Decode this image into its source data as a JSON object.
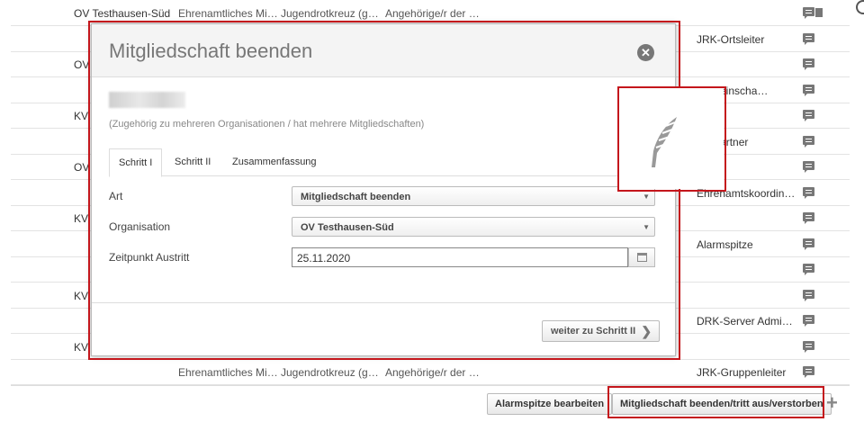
{
  "rows": [
    {
      "org": "OV Testhausen-Süd",
      "func": "Ehrenamtliches Mi…",
      "group": "Jugendrotkreuz (g…",
      "member": "Angehörige/r der …",
      "role": "",
      "icons": "comment-trash"
    },
    {
      "org": "",
      "func": "",
      "group": "",
      "member": "",
      "role": "JRK-Ortsleiter",
      "icons": "comment"
    },
    {
      "org": "OV",
      "func": "",
      "group": "",
      "member": "",
      "role": "",
      "icons": "comment"
    },
    {
      "org": "",
      "func": "",
      "group": "",
      "member": "",
      "role": "Gemeinscha…",
      "icons": "comment"
    },
    {
      "org": "KV",
      "func": "",
      "group": "",
      "member": "",
      "role": "",
      "icons": "comment"
    },
    {
      "org": "",
      "func": "",
      "group": "",
      "member": "",
      "role": "echpartner",
      "icons": "comment"
    },
    {
      "org": "OV",
      "func": "",
      "group": "",
      "member": "",
      "role": "",
      "icons": "comment"
    },
    {
      "org": "",
      "func": "",
      "group": "",
      "member": "",
      "role": "Ehrenamtskoordin…",
      "icons": "comment"
    },
    {
      "org": "KV",
      "func": "",
      "group": "",
      "member": "",
      "role": "",
      "icons": "comment"
    },
    {
      "org": "",
      "func": "",
      "group": "",
      "member": "",
      "role": "Alarmspitze",
      "icons": "comment"
    },
    {
      "org": "",
      "func": "",
      "group": "",
      "member": "",
      "role": "",
      "icons": "comment"
    },
    {
      "org": "KV",
      "func": "",
      "group": "",
      "member": "",
      "role": "",
      "icons": "comment"
    },
    {
      "org": "",
      "func": "",
      "group": "",
      "member": "",
      "role": "DRK-Server Admi…",
      "icons": "comment"
    },
    {
      "org": "KV",
      "func": "",
      "group": "",
      "member": "",
      "role": "",
      "icons": "comment"
    },
    {
      "org": "",
      "func": "Ehrenamtliches Mi…",
      "group": "Jugendrotkreuz (g…",
      "member": "Angehörige/r der …",
      "role": "JRK-Gruppenleiter",
      "icons": "comment"
    }
  ],
  "bottom_bar": {
    "edit_alarm_label": "Alarmspitze bearbeiten",
    "end_membership_label": "Mitgliedschaft beenden/tritt aus/verstorben",
    "add_label": "+"
  },
  "modal": {
    "title": "Mitgliedschaft beenden",
    "close_label": "✕",
    "note": "(Zugehörig zu mehreren Organisationen / hat mehrere Mitgliedschaften)",
    "tabs": [
      {
        "label": "Schritt I"
      },
      {
        "label": "Schritt II"
      },
      {
        "label": "Zusammenfassung"
      }
    ],
    "fields": {
      "art_label": "Art",
      "art_value": "Mitgliedschaft beenden",
      "org_label": "Organisation",
      "org_value": "OV Testhausen-Süd",
      "date_label": "Zeitpunkt Austritt",
      "date_value": "25.11.2020"
    },
    "next_label": "weiter zu Schritt II",
    "next_icon": "chevron-right-icon"
  },
  "colors": {
    "highlight": "#c4161c",
    "icon": "#777777"
  }
}
